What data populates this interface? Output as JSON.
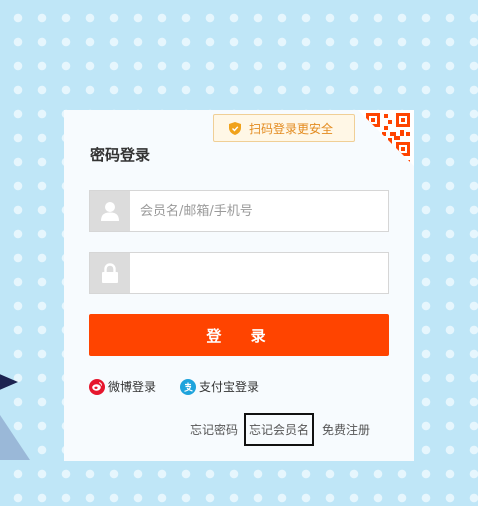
{
  "panel": {
    "title": "密码登录",
    "scan_tip": "扫码登录更安全",
    "username": {
      "placeholder": "会员名/邮箱/手机号",
      "value": ""
    },
    "password": {
      "placeholder": "",
      "value": ""
    },
    "login_button": "登 录",
    "alt_logins": {
      "weibo": "微博登录",
      "alipay": "支付宝登录"
    },
    "links": {
      "forgot_password": "忘记密码",
      "forgot_username": "忘记会员名",
      "register": "免费注册"
    }
  },
  "icons": {
    "weibo": "weibo-icon",
    "alipay": "alipay-icon",
    "user": "user-icon",
    "lock": "lock-icon",
    "shield": "shield-icon",
    "qr": "qr-code-icon"
  },
  "colors": {
    "accent": "#ff4400",
    "tip_text": "#e38b1f",
    "weibo": "#e6162d",
    "alipay": "#1ea3dc"
  }
}
